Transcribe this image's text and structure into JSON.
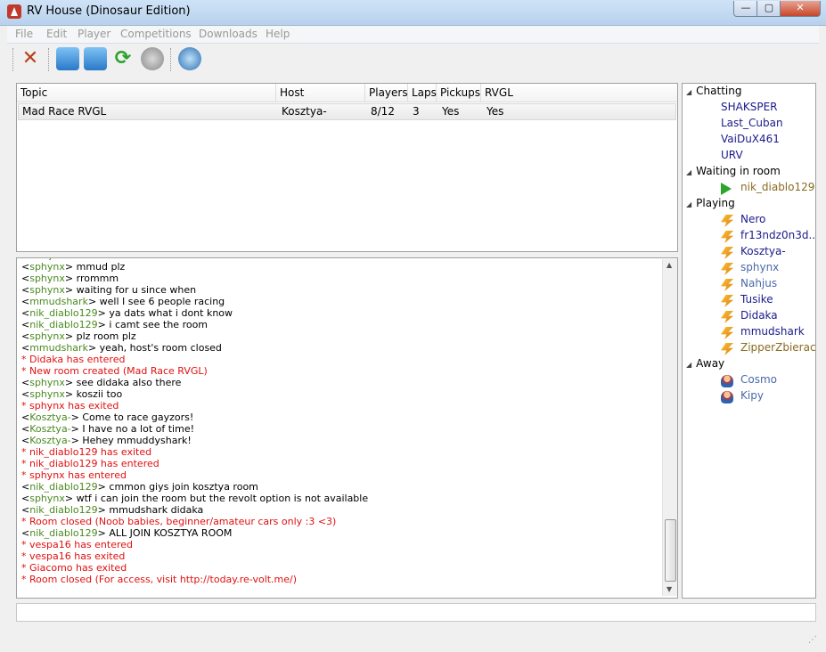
{
  "window": {
    "title": "RV House (Dinosaur Edition)",
    "minimize": "—",
    "maximize": "▢",
    "close": "✕"
  },
  "menu": [
    "File",
    "Edit",
    "Player",
    "Competitions",
    "Downloads",
    "Help"
  ],
  "rooms": {
    "columns": [
      "Topic",
      "Host",
      "Players",
      "Laps",
      "Pickups",
      "RVGL"
    ],
    "rows": [
      [
        "Mad Race RVGL",
        "Kosztya-",
        "8/12",
        "3",
        "Yes",
        "Yes"
      ]
    ]
  },
  "chat": [
    {
      "n": "Nahjus",
      "t": "thanks a mmudd r..."
    },
    {
      "n": "sphynx",
      "t": "mmud plz"
    },
    {
      "n": "sphynx",
      "t": "rrommm"
    },
    {
      "n": "sphynx",
      "t": "waiting for u since when"
    },
    {
      "n": "mmudshark",
      "t": "well I see 6 people racing"
    },
    {
      "n": "nik_diablo129",
      "t": "ya dats what i dont know"
    },
    {
      "n": "nik_diablo129",
      "t": "i camt see the room"
    },
    {
      "n": "sphynx",
      "t": "plz room plz"
    },
    {
      "n": "mmudshark",
      "t": "yeah, host's room closed"
    },
    {
      "s": "* Didaka has entered"
    },
    {
      "s": "* New room created (Mad Race RVGL)"
    },
    {
      "n": "sphynx",
      "t": "see didaka also there"
    },
    {
      "n": "sphynx",
      "t": "koszii too"
    },
    {
      "s": "* sphynx has exited"
    },
    {
      "n": "Kosztya-",
      "t": "Come to race gayzors!"
    },
    {
      "n": "Kosztya-",
      "t": "I have no a lot of time!"
    },
    {
      "n": "Kosztya-",
      "t": "Hehey mmuddyshark!"
    },
    {
      "s": "* nik_diablo129 has exited"
    },
    {
      "s": "* nik_diablo129 has entered"
    },
    {
      "s": "* sphynx has entered"
    },
    {
      "n": "nik_diablo129",
      "t": "cmmon giys join kosztya room"
    },
    {
      "n": "sphynx",
      "t": "wtf i can join the room but the revolt option is not available"
    },
    {
      "n": "nik_diablo129",
      "t": "mmudshark didaka"
    },
    {
      "s": "* Room closed (Noob babies, beginner/amateur cars only :3 <3)"
    },
    {
      "n": "nik_diablo129",
      "t": "ALL JOIN KOSZTYA ROOM"
    },
    {
      "s": "* vespa16 has entered"
    },
    {
      "s": "* vespa16 has exited"
    },
    {
      "s": "* Giacomo has exited"
    },
    {
      "s": "* Room closed (For access, visit http://today.re-volt.me/)"
    }
  ],
  "users": {
    "groups": [
      {
        "label": "Chatting",
        "icon": "none",
        "members": [
          {
            "name": "SHAKSPER",
            "color": "#1a1a8c"
          },
          {
            "name": "Last_Cuban",
            "color": "#1a1a8c"
          },
          {
            "name": "VaiDuX461",
            "color": "#1a1a8c"
          },
          {
            "name": "URV",
            "color": "#1a1a8c"
          }
        ]
      },
      {
        "label": "Waiting in room",
        "icon": "play-icon",
        "members": [
          {
            "name": "nik_diablo129",
            "color": "#8a6a20"
          }
        ]
      },
      {
        "label": "Playing",
        "icon": "car-icon",
        "members": [
          {
            "name": "Nero",
            "color": "#1a1a8c"
          },
          {
            "name": "fr13ndz0n3d...",
            "color": "#1a1a8c"
          },
          {
            "name": "Kosztya-",
            "color": "#1a1a8c"
          },
          {
            "name": "sphynx",
            "color": "#4a6aa8"
          },
          {
            "name": "Nahjus",
            "color": "#4a6aa8"
          },
          {
            "name": "Tusike",
            "color": "#1a1a8c"
          },
          {
            "name": "Didaka",
            "color": "#1a1a8c"
          },
          {
            "name": "mmudshark",
            "color": "#1a1a8c"
          },
          {
            "name": "ZipperZbieracz",
            "color": "#8a6a20"
          }
        ]
      },
      {
        "label": "Away",
        "icon": "person-icon",
        "members": [
          {
            "name": "Cosmo",
            "color": "#4a6aa8"
          },
          {
            "name": "Kipy",
            "color": "#4a6aa8"
          }
        ]
      }
    ]
  }
}
